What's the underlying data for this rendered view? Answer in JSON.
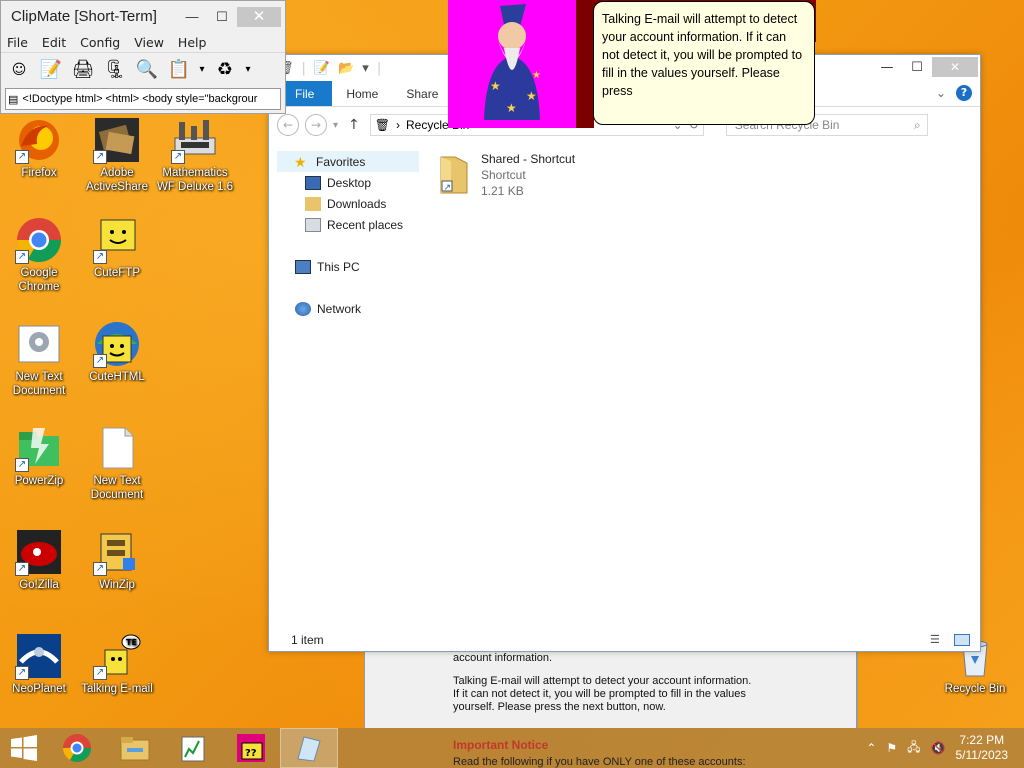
{
  "clipmate": {
    "title": "ClipMate [Short-Term]",
    "menu": [
      "File",
      "Edit",
      "Config",
      "View",
      "Help"
    ],
    "preview_text": "<!Doctype html> <html> <body style=\"backgrour"
  },
  "explorer": {
    "tabs": [
      "File",
      "Home",
      "Share"
    ],
    "address": "Recycle Bin",
    "search_placeholder": "Search Recycle Bin",
    "nav": {
      "favorites": "Favorites",
      "desktop": "Desktop",
      "downloads": "Downloads",
      "recent": "Recent places",
      "this_pc": "This PC",
      "network": "Network"
    },
    "file": {
      "name": "Shared - Shortcut",
      "type": "Shortcut",
      "size": "1.21 KB"
    },
    "status": "1 item"
  },
  "balloon": {
    "text": "Talking E-mail will attempt to detect your account information. If it can not detect it, you will be prompted to fill in the values yourself. Please press"
  },
  "bg_dialog": {
    "line0": "account information.",
    "line1": "Talking E-mail will attempt to detect your account information.",
    "line2": "If it can not detect it, you will be prompted to fill in the values",
    "line3": "yourself. Please press the next button, now.",
    "notice_title": "Important Notice",
    "notice_text": "Read the following if you have ONLY one of these accounts:"
  },
  "desktop_icons": {
    "firefox": "Firefox",
    "adobe": "Adobe ActiveShare",
    "mathematics": "Mathematics WF Deluxe 1.6",
    "chrome": "Google Chrome",
    "cuteftp": "CuteFTP",
    "newtext1": "New Text Document",
    "cutehtml": "CuteHTML",
    "powerzip": "PowerZip",
    "newtext2": "New Text Document",
    "golzilla": "Go!Zilla",
    "winzip": "WinZip",
    "neoplanet": "NeoPlanet",
    "talkingemail": "Talking E-mail",
    "recyclebin": "Recycle Bin"
  },
  "taskbar": {
    "time": "7:22 PM",
    "date": "5/11/2023"
  }
}
